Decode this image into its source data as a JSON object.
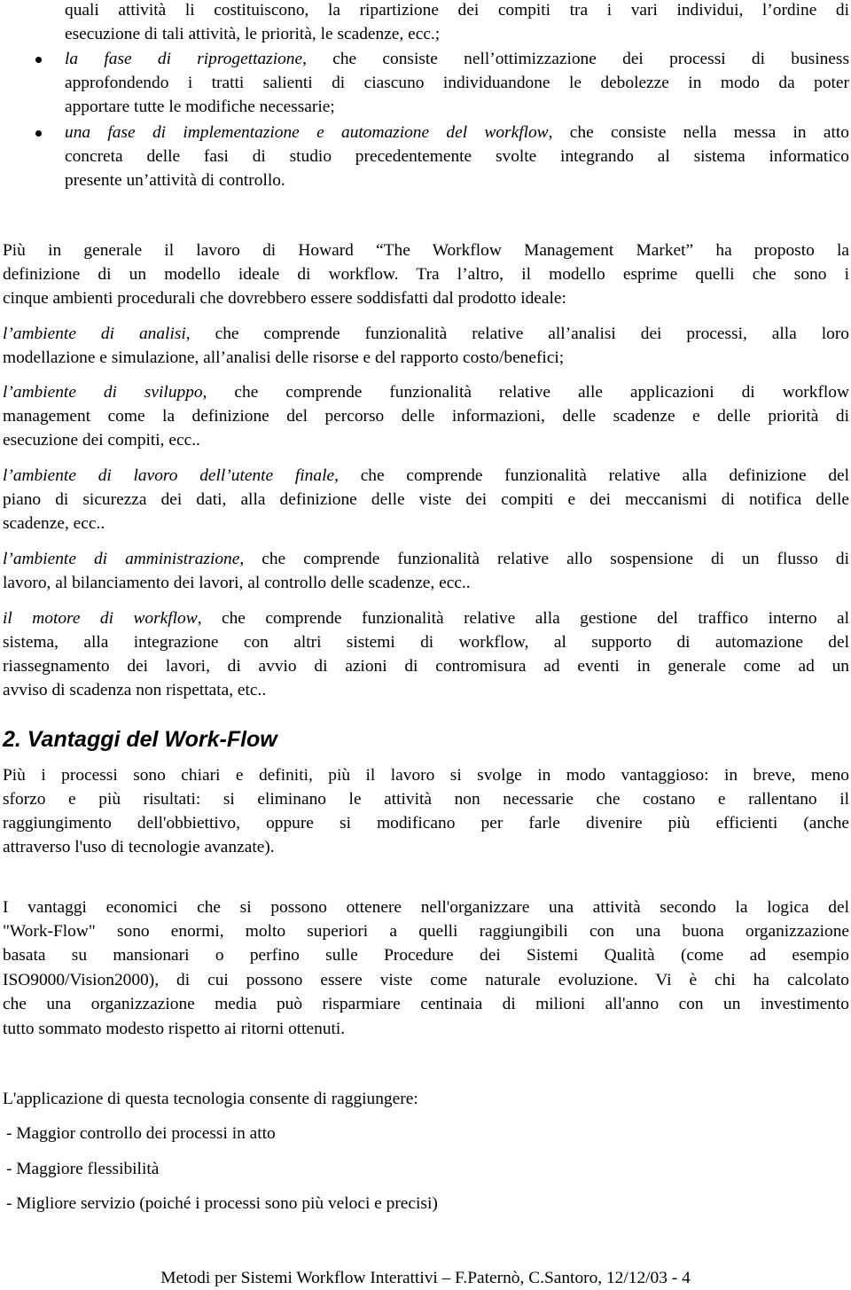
{
  "intro_continuation": {
    "lines": [
      "quali attività li costituiscono, la ripartizione dei compiti tra i vari individui, l’ordine di",
      "esecuzione di tali attività, le priorità, le scadenze, ecc.;"
    ]
  },
  "bullets": [
    {
      "term": "la fase di riprogettazione",
      "lines": [
        ", che consiste nell’ottimizzazione dei processi di business",
        "approfondendo i tratti salienti di ciascuno individuandone le debolezze in modo da poter",
        "apportare tutte le modifiche necessarie;"
      ]
    },
    {
      "term": "una fase di implementazione e automazione del workflow",
      "lines": [
        ", che consiste nella messa in atto",
        "concreta delle fasi di studio precedentemente svolte integrando al sistema informatico",
        "presente un’attività di controllo."
      ]
    }
  ],
  "howard_paragraph": {
    "lines": [
      "Più in generale il lavoro di Howard “The Workflow Management Market” ha proposto la",
      "definizione di un modello ideale di workflow. Tra l’altro, il modello esprime quelli che sono i",
      "cinque ambienti procedurali che dovrebbero essere soddisfatti dal prodotto ideale:"
    ]
  },
  "environments": [
    {
      "term": "l’ambiente di analisi",
      "lines": [
        ", che comprende funzionalità relative all’analisi dei processi, alla loro",
        "modellazione e simulazione, all’analisi delle risorse e del rapporto costo/benefici;"
      ]
    },
    {
      "term": "l’ambiente di sviluppo",
      "lines": [
        ", che comprende funzionalità relative alle applicazioni di workflow",
        "management come la definizione del percorso delle informazioni, delle scadenze e delle priorità di",
        "esecuzione dei compiti, ecc.."
      ]
    },
    {
      "term": "l’ambiente di lavoro dell’utente finale",
      "lines": [
        ", che comprende funzionalità relative alla definizione del",
        "piano di sicurezza dei dati, alla definizione delle viste dei compiti e dei meccanismi di notifica delle",
        "scadenze, ecc.."
      ]
    },
    {
      "term": "l’ambiente di amministrazione",
      "lines": [
        ", che comprende funzionalità relative allo sospensione di un flusso di",
        "lavoro, al bilanciamento dei lavori, al controllo delle scadenze, ecc.."
      ]
    },
    {
      "term": "il motore di workflow",
      "lines": [
        ", che comprende funzionalità relative alla gestione del traffico interno al",
        "sistema, alla integrazione con altri sistemi di workflow, al supporto di automazione del",
        "riassegnamento dei lavori, di avvio di azioni di contromisura ad eventi in generale come ad un",
        "avviso di scadenza non rispettata, etc.."
      ]
    }
  ],
  "section": {
    "heading": "2. Vantaggi del Work-Flow",
    "paragraph1": [
      "Più i processi sono chiari e definiti, più il lavoro si svolge in modo vantaggioso: in breve, meno",
      "sforzo e più risultati: si eliminano le attività non necessarie che costano e rallentano il",
      "raggiungimento dell'obbiettivo, oppure si modificano per farle divenire più efficienti (anche",
      "attraverso l'uso di tecnologie avanzate)."
    ],
    "paragraph2": [
      "I vantaggi economici che si possono ottenere nell'organizzare una attività secondo la logica del",
      "\"Work-Flow\" sono enormi, molto superiori a quelli raggiungibili con una buona organizzazione",
      "basata su mansionari o perfino sulle Procedure dei Sistemi Qualità (come ad esempio",
      "ISO9000/Vision2000), di cui possono essere viste come naturale evoluzione. Vi è chi ha calcolato",
      "che una organizzazione media può risparmiare centinaia di milioni all'anno con un investimento",
      "tutto sommato modesto rispetto ai ritorni ottenuti."
    ],
    "benefits_intro": "L'applicazione di questa tecnologia consente di raggiungere:",
    "benefits": [
      "- Maggior controllo dei processi in atto",
      "- Maggiore flessibilità",
      "- Migliore servizio (poiché i processi sono più veloci e precisi)"
    ]
  },
  "footer": "Metodi per Sistemi Workflow Interattivi – F.Paternò, C.Santoro, 12/12/03 - 4"
}
